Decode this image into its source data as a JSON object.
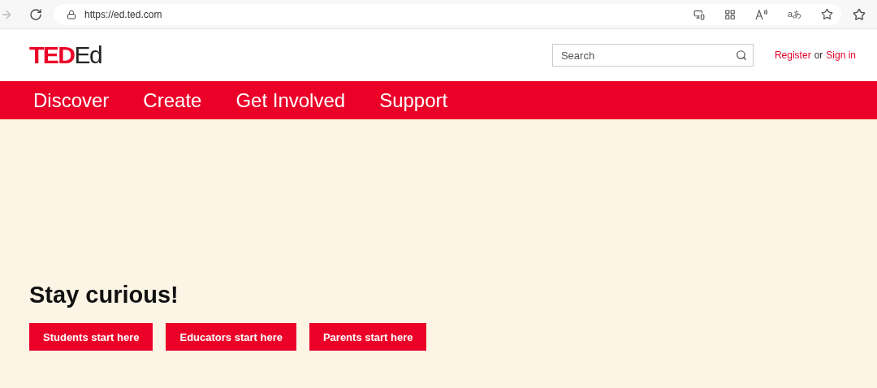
{
  "browser": {
    "url": "https://ed.ted.com",
    "translate_label": "aあ"
  },
  "header": {
    "logo": {
      "brand": "TED",
      "sub": "Ed"
    },
    "search": {
      "placeholder": "Search"
    },
    "auth": [
      {
        "kind": "link",
        "text": "Register"
      },
      {
        "kind": "text",
        "text": "or"
      },
      {
        "kind": "link",
        "text": "Sign in"
      }
    ]
  },
  "nav": {
    "items": [
      "Discover",
      "Create",
      "Get Involved",
      "Support"
    ]
  },
  "hero": {
    "title": "Stay curious!",
    "buttons": [
      "Students start here",
      "Educators start here",
      "Parents start here"
    ]
  }
}
